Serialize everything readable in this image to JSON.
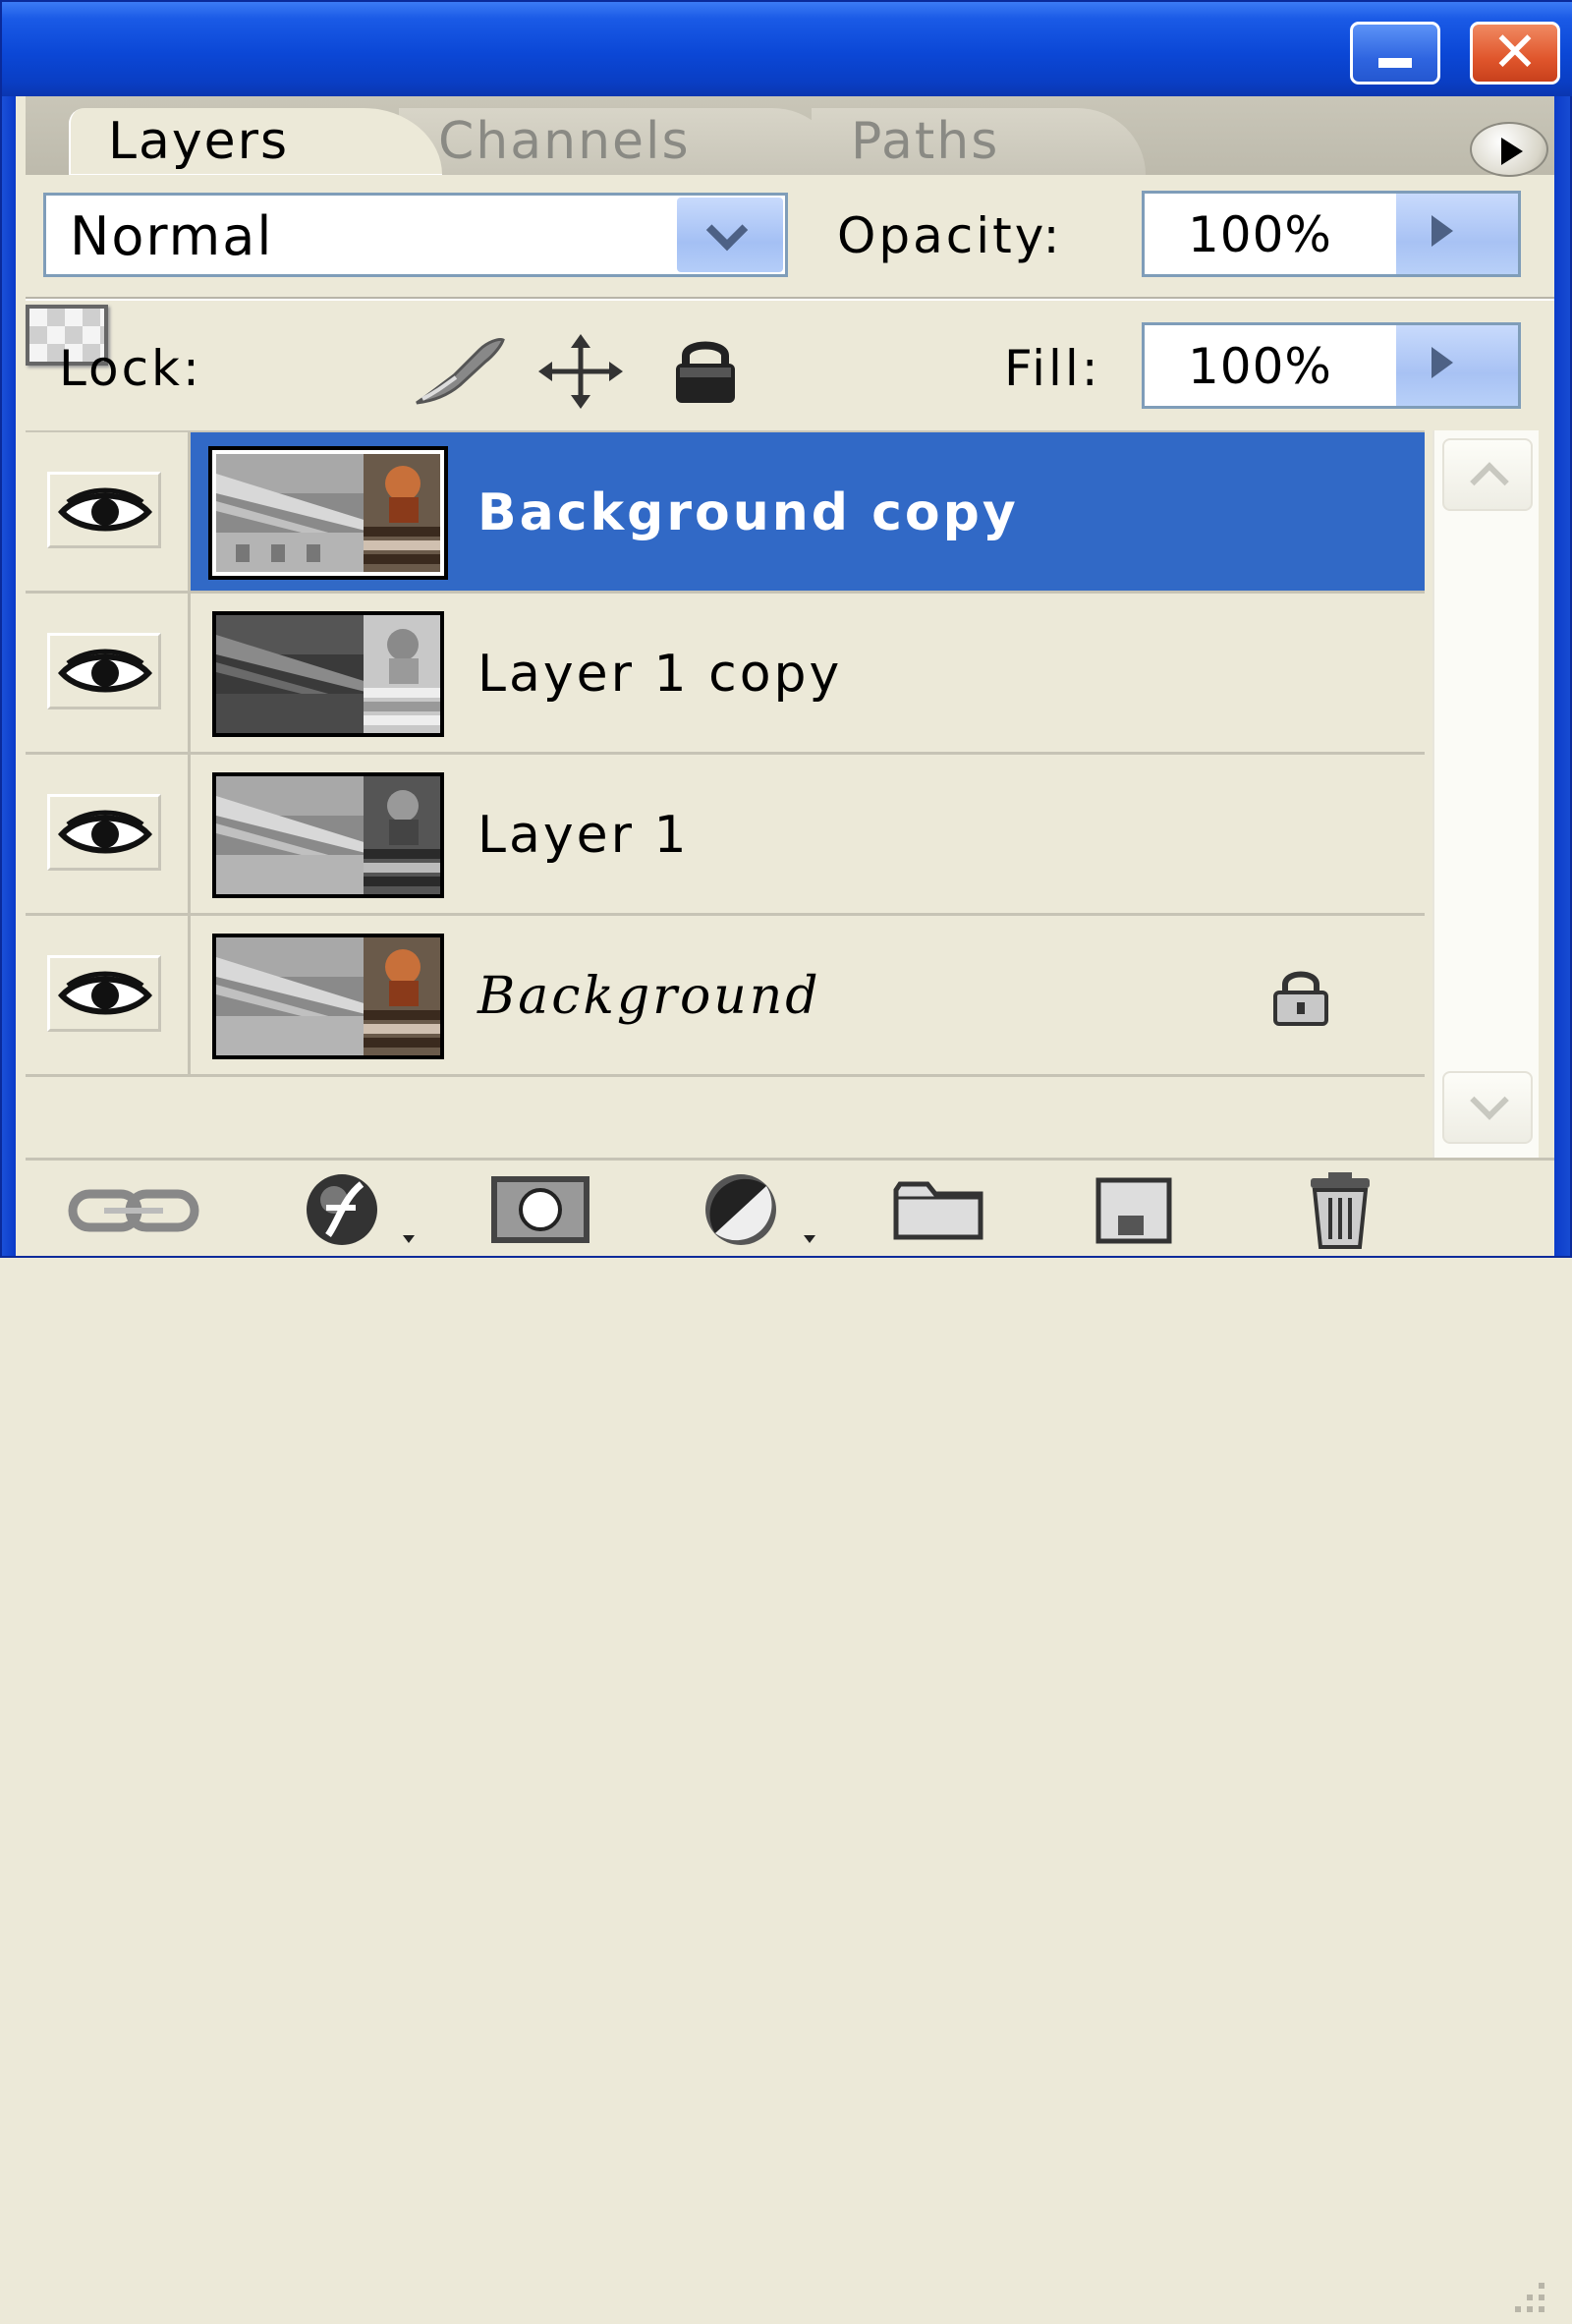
{
  "window": {
    "titlebar_buttons": [
      {
        "name": "minimize",
        "icon": "minimize-icon"
      },
      {
        "name": "close",
        "icon": "close-icon",
        "glyph": "✕"
      }
    ]
  },
  "tabs": [
    {
      "label": "Layers",
      "active": true
    },
    {
      "label": "Channels",
      "active": false
    },
    {
      "label": "Paths",
      "active": false
    }
  ],
  "panel_menu": {
    "icon": "play-arrow-icon"
  },
  "blend_mode": {
    "value": "Normal",
    "icon": "chevron-down-icon"
  },
  "opacity": {
    "label": "Opacity:",
    "value": "100%"
  },
  "lock": {
    "label": "Lock:",
    "icons": [
      "lock-transparent-pixels-icon",
      "brush-icon",
      "move-arrows-icon",
      "padlock-icon"
    ]
  },
  "fill": {
    "label": "Fill:",
    "value": "100%"
  },
  "layers": [
    {
      "name": "Background copy",
      "selected": true,
      "visible": true,
      "italic": false,
      "locked": false
    },
    {
      "name": "Layer 1 copy",
      "selected": false,
      "visible": true,
      "italic": false,
      "locked": false
    },
    {
      "name": "Layer 1",
      "selected": false,
      "visible": true,
      "italic": false,
      "locked": false
    },
    {
      "name": "Background",
      "selected": false,
      "visible": true,
      "italic": true,
      "locked": true
    }
  ],
  "bottom_tools": [
    "link-icon",
    "fx-icon",
    "layer-mask-icon",
    "half-circle-icon",
    "folder-icon",
    "new-layer-icon",
    "trash-icon"
  ],
  "colors": {
    "titlebar": "#0b47d6",
    "panel": "#ece9d8",
    "selection": "#3169c6",
    "field_border": "#7f9db9",
    "arrow_button": "#a8c2f4"
  }
}
